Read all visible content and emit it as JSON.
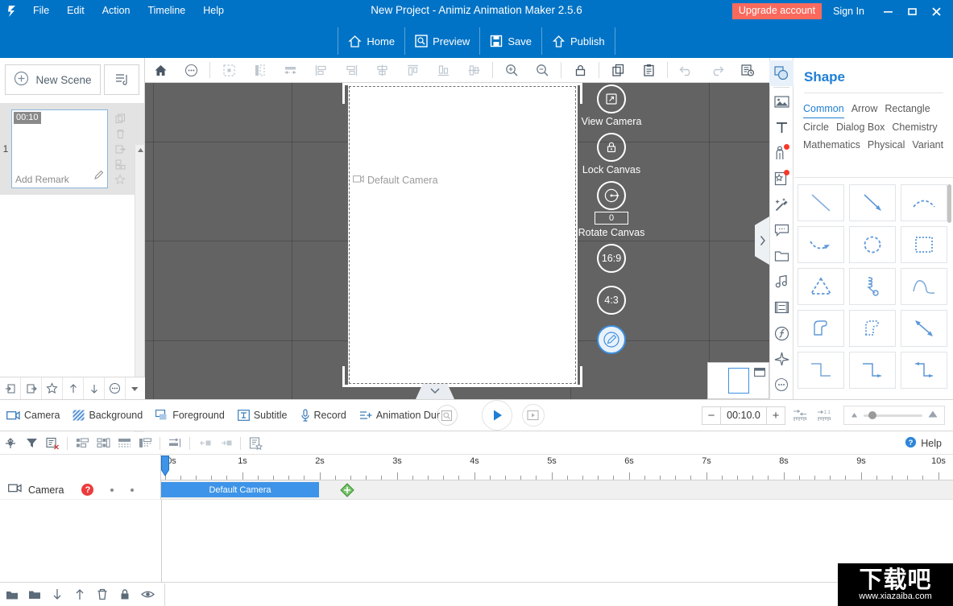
{
  "titlebar": {
    "app_icon": "animiz-logo-icon",
    "menus": [
      "File",
      "Edit",
      "Action",
      "Timeline",
      "Help"
    ],
    "window_title": "New Project - Animiz Animation Maker 2.5.6",
    "upgrade_label": "Upgrade account",
    "signin_label": "Sign In",
    "minimize_icon": "minimize-icon",
    "maximize_icon": "maximize-icon",
    "close_icon": "close-icon",
    "accent_color": "#0073c6",
    "upgrade_color": "#f96a5d",
    "quick_actions": [
      {
        "label": "Home",
        "icon": "home-icon"
      },
      {
        "label": "Preview",
        "icon": "preview-icon"
      },
      {
        "label": "Save",
        "icon": "save-icon"
      },
      {
        "label": "Publish",
        "icon": "publish-icon"
      }
    ]
  },
  "scene_panel": {
    "new_scene_label": "New Scene",
    "scene_list_icon": "scene-list-icon",
    "scene": {
      "number": "1",
      "duration": "00:10",
      "remark_placeholder": "Add Remark",
      "edit_icon": "pencil-icon"
    },
    "side_tools": [
      "copy-icon",
      "delete-icon",
      "export-icon",
      "duplicate-icon",
      "star-icon"
    ],
    "footer_tools": [
      "import-scene-icon",
      "export-scene-icon",
      "favorite-icon",
      "move-up-icon",
      "move-down-icon",
      "more-icon"
    ],
    "collapse_icon": "chevron-down-icon"
  },
  "canvas_toolbar": {
    "tools": [
      "home-icon",
      "more-icon",
      "select-all-icon",
      "align-center-vertical-icon",
      "distribute-icon",
      "align-left-icon",
      "align-right-icon",
      "align-center-h-icon",
      "align-top-icon",
      "align-bottom-icon",
      "align-middle-icon",
      "zoom-in-icon",
      "zoom-out-icon",
      "lock-icon",
      "copy-icon",
      "paste-icon",
      "undo-icon",
      "redo-icon",
      "history-icon"
    ]
  },
  "canvas": {
    "background_color": "#636363",
    "camera_label": "Default Camera",
    "camera_icon": "camera-icon",
    "controls": [
      {
        "id": "view-camera",
        "icon": "view-camera-icon",
        "label": "View Camera"
      },
      {
        "id": "lock-canvas",
        "icon": "lock-icon",
        "label": "Lock Canvas"
      },
      {
        "id": "rotate-canvas",
        "icon": "rotate-icon",
        "label": "Rotate Canvas",
        "value": "0"
      }
    ],
    "ratios": [
      "16:9",
      "4:3"
    ],
    "pen_icon": "pen-icon",
    "collapse_icon": "chevron-down-icon",
    "expand_icon": "chevron-right-icon",
    "mini_preview_icon": "window-icon"
  },
  "rail": {
    "items": [
      {
        "id": "shape",
        "icon": "shape-icon",
        "active": true,
        "badge": false
      },
      {
        "id": "image",
        "icon": "image-icon",
        "active": false,
        "badge": false
      },
      {
        "id": "text",
        "icon": "text-icon",
        "active": false,
        "badge": false
      },
      {
        "id": "character",
        "icon": "character-icon",
        "active": false,
        "badge": true
      },
      {
        "id": "sticker",
        "icon": "sticker-icon",
        "active": false,
        "badge": true
      },
      {
        "id": "effect",
        "icon": "magic-wand-icon",
        "active": false,
        "badge": false
      },
      {
        "id": "callout",
        "icon": "callout-icon",
        "active": false,
        "badge": false
      },
      {
        "id": "folder",
        "icon": "folder-icon",
        "active": false,
        "badge": false
      },
      {
        "id": "music",
        "icon": "music-icon",
        "active": false,
        "badge": false
      },
      {
        "id": "video",
        "icon": "film-icon",
        "active": false,
        "badge": false
      },
      {
        "id": "formula",
        "icon": "formula-icon",
        "active": false,
        "badge": false
      },
      {
        "id": "plane",
        "icon": "plane-icon",
        "active": false,
        "badge": false
      },
      {
        "id": "more",
        "icon": "more-icon",
        "active": false,
        "badge": false
      }
    ]
  },
  "shape_panel": {
    "title": "Shape",
    "tabs": [
      {
        "label": "Common",
        "active": true
      },
      {
        "label": "Arrow",
        "active": false
      },
      {
        "label": "Rectangle",
        "active": false
      },
      {
        "label": "Circle",
        "active": false
      },
      {
        "label": "Dialog Box",
        "active": false
      },
      {
        "label": "Chemistry",
        "active": false
      },
      {
        "label": "Mathematics",
        "active": false
      },
      {
        "label": "Physical",
        "active": false
      },
      {
        "label": "Variant",
        "active": false
      }
    ],
    "shapes": [
      "line-icon",
      "arrow-line-icon",
      "dashed-arc-icon",
      "curved-arrow-icon",
      "dashed-circle-icon",
      "dotted-rect-icon",
      "dashed-triangle-icon",
      "spring-icon",
      "wave-curve-icon",
      "solid-blob-icon",
      "dotted-blob-icon",
      "double-arrow-icon",
      "step-line-icon",
      "step-arrow-icon",
      "double-step-arrow-icon"
    ],
    "accent_color": "#1f7fd4"
  },
  "bottom_bar": {
    "items": [
      {
        "label": "Camera",
        "icon": "camera-icon"
      },
      {
        "label": "Background",
        "icon": "background-icon"
      },
      {
        "label": "Foreground",
        "icon": "foreground-icon"
      },
      {
        "label": "Subtitle",
        "icon": "subtitle-icon"
      },
      {
        "label": "Record",
        "icon": "mic-icon"
      },
      {
        "label": "Animation Dura",
        "icon": "animation-duration-icon"
      }
    ],
    "magnifier_icon": "magnifier-icon",
    "play_icon": "play-icon",
    "preview_icon": "preview-play-icon",
    "duration": {
      "minus": "−",
      "value": "00:10.0",
      "plus": "+"
    },
    "fit_icons": [
      "fit-selection-icon",
      "fit-all-icon"
    ],
    "zoom_slider": {
      "min_icon": "zoom-small-icon",
      "max_icon": "zoom-large-icon",
      "value": 8
    }
  },
  "timeline_toolbar": {
    "tools": [
      "keyframe-icon",
      "filter-icon",
      "clear-filter-icon",
      "align-clip-left-icon",
      "align-clip-center-icon",
      "align-clip-seq-icon",
      "align-clip-stack-icon",
      "adjust-icon",
      "trim-left-icon",
      "trim-right-icon",
      "bookmark-icon"
    ],
    "help_label": "Help",
    "help_icon": "help-icon"
  },
  "timeline": {
    "ruler_labels": [
      "0s",
      "1s",
      "2s",
      "3s",
      "4s",
      "5s",
      "6s",
      "7s",
      "8s",
      "9s",
      "10s"
    ],
    "playhead_position_s": 0,
    "track": {
      "icon": "camera-icon",
      "name": "Camera",
      "badge": "?",
      "badge_color": "#ed3b3b",
      "dots": 2,
      "clip": {
        "label": "Default Camera",
        "start_s": 0,
        "end_s": 2.0,
        "color": "#3d94e8"
      },
      "keyframe_marker_s": 2.37
    }
  },
  "status_bar": {
    "icons": [
      "add-media-icon",
      "folder-icon",
      "move-down-icon",
      "move-up-icon",
      "delete-icon",
      "lock-icon",
      "eye-icon"
    ]
  },
  "watermark": {
    "text_cn": "下载吧",
    "url": "www.xiazaiba.com"
  }
}
